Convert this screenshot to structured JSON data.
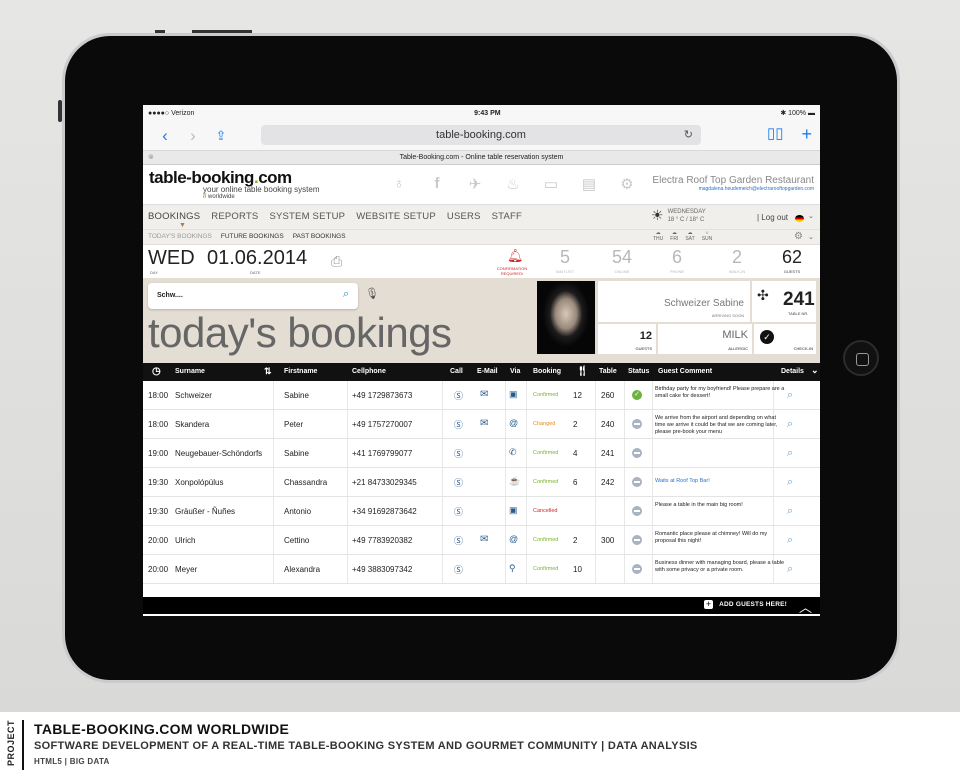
{
  "statusbar": {
    "carrier": "●●●●○ Verizon",
    "time": "9:43 PM",
    "battery": "100%"
  },
  "browser": {
    "url": "table-booking.com",
    "tab_title": "Table-Booking.com - Online table reservation system"
  },
  "site": {
    "logo": "table-booking",
    "logo_dot": ".",
    "logo_tld": "com",
    "tagline": "your online table booking system",
    "worldwide": "worldwide",
    "restaurant_name": "Electra Roof Top Garden Restaurant",
    "restaurant_email": "magdalena.heudemeich@electrarooftopgarden.com"
  },
  "menu": {
    "main": [
      "BOOKINGS",
      "REPORTS",
      "SYSTEM SETUP",
      "WEBSITE SETUP",
      "USERS",
      "STAFF"
    ],
    "sub": [
      "TODAY'S BOOKINGS",
      "FUTURE BOOKINGS",
      "PAST BOOKINGS"
    ],
    "logout": "| Log out"
  },
  "weather": {
    "day": "WEDNESDAY",
    "temp": "18 ° C / 18° C",
    "forecast": [
      "THU",
      "FRI",
      "SAT",
      "SUN"
    ]
  },
  "datebar": {
    "dow": "WED",
    "dow_label": "DAY",
    "date": "01.06.2014",
    "date_label": "DATE",
    "confirmation": "CONFIRMATION REQUIRED!",
    "stats": [
      {
        "n": "5",
        "l": "WAITLIST"
      },
      {
        "n": "54",
        "l": "ONLINE"
      },
      {
        "n": "6",
        "l": "PHONE"
      },
      {
        "n": "2",
        "l": "WALK-IN"
      },
      {
        "n": "62",
        "l": "GUESTS"
      }
    ]
  },
  "hero": {
    "search_value": "Schw....",
    "title": "today's bookings",
    "guest_name": "Schweizer Sabine",
    "guest_status": "ARRIVING SOON",
    "table_nr": "241",
    "table_label": "TABLE NR.",
    "guests": "12",
    "guests_label": "GUESTS",
    "allergy": "MILK",
    "allergy_label": "ALLERGIC",
    "checkin_label": "CHECK-IN"
  },
  "table": {
    "headers": {
      "surname": "Surname",
      "firstname": "Firstname",
      "cellphone": "Cellphone",
      "call": "Call",
      "email": "E-Mail",
      "via": "Via",
      "booking": "Booking",
      "table": "Table",
      "status": "Status",
      "comment": "Guest Comment",
      "details": "Details"
    },
    "rows": [
      {
        "time": "18:00",
        "surname": "Schweizer",
        "first": "Sabine",
        "phone": "+49 1729873673",
        "email": true,
        "via": "▣",
        "booking": "Confirmed",
        "guests": "12",
        "table": "260",
        "status": "ok",
        "comment": "Birthday party for my boyfriend! Please prepare are a small cake for dessert!"
      },
      {
        "time": "18:00",
        "surname": "Skandera",
        "first": "Peter",
        "phone": "+49 1757270007",
        "email": true,
        "via": "@",
        "booking": "Changed",
        "guests": "2",
        "table": "240",
        "status": "minus",
        "comment": "We arrive from the airport and depending on what time we arrive it could be that we are coming later, please pre-book your menu"
      },
      {
        "time": "19:00",
        "surname": "Neugebauer-Schöndorfs",
        "first": "Sabine",
        "phone": "+41 1769799077",
        "email": false,
        "via": "✆",
        "booking": "Confirmed",
        "guests": "4",
        "table": "241",
        "status": "minus",
        "comment": ""
      },
      {
        "time": "19:30",
        "surname": "Xonpolópúlus",
        "first": "Chassandra",
        "phone": "+21 84733029345",
        "email": false,
        "via": "☕",
        "booking": "Confirmed",
        "guests": "6",
        "table": "242",
        "status": "minus",
        "comment": "Waits at Roof Top Bar!"
      },
      {
        "time": "19:30",
        "surname": "Gräußer - Ñuñes",
        "first": "Antonio",
        "phone": "+34 91692873642",
        "email": false,
        "via": "▣",
        "booking": "Cancelled",
        "guests": "",
        "table": "",
        "status": "minus",
        "comment": "Please a table in the main big room!"
      },
      {
        "time": "20:00",
        "surname": "Ulrich",
        "first": "Cettino",
        "phone": "+49 7783920382",
        "email": true,
        "via": "@",
        "booking": "Confirmed",
        "guests": "2",
        "table": "300",
        "status": "minus",
        "comment": "Romantic place please at chimney! Will do my proposal this night!"
      },
      {
        "time": "20:00",
        "surname": "Meyer",
        "first": "Alexandra",
        "phone": "+49 3883097342",
        "email": false,
        "via": "⚲",
        "booking": "Confirmed",
        "guests": "10",
        "table": "",
        "status": "minus",
        "comment": "Business dinner with managing board, please a table with some privacy or a private room."
      }
    ]
  },
  "footer": {
    "add_guests": "ADD GUESTS HERE!"
  },
  "caption": {
    "label": "PROJECT",
    "title": "TABLE-BOOKING.COM WORLDWIDE",
    "subtitle": "SOFTWARE DEVELOPMENT OF A REAL-TIME TABLE-BOOKING SYSTEM AND GOURMET COMMUNITY | DATA ANALYSIS",
    "tags": "HTML5 | BIG DATA"
  },
  "colors": {
    "accent_green": "#7ab32e",
    "alert_red": "#c8282e",
    "link_blue": "#2a72c8",
    "ios_blue": "#1a7ef0"
  }
}
